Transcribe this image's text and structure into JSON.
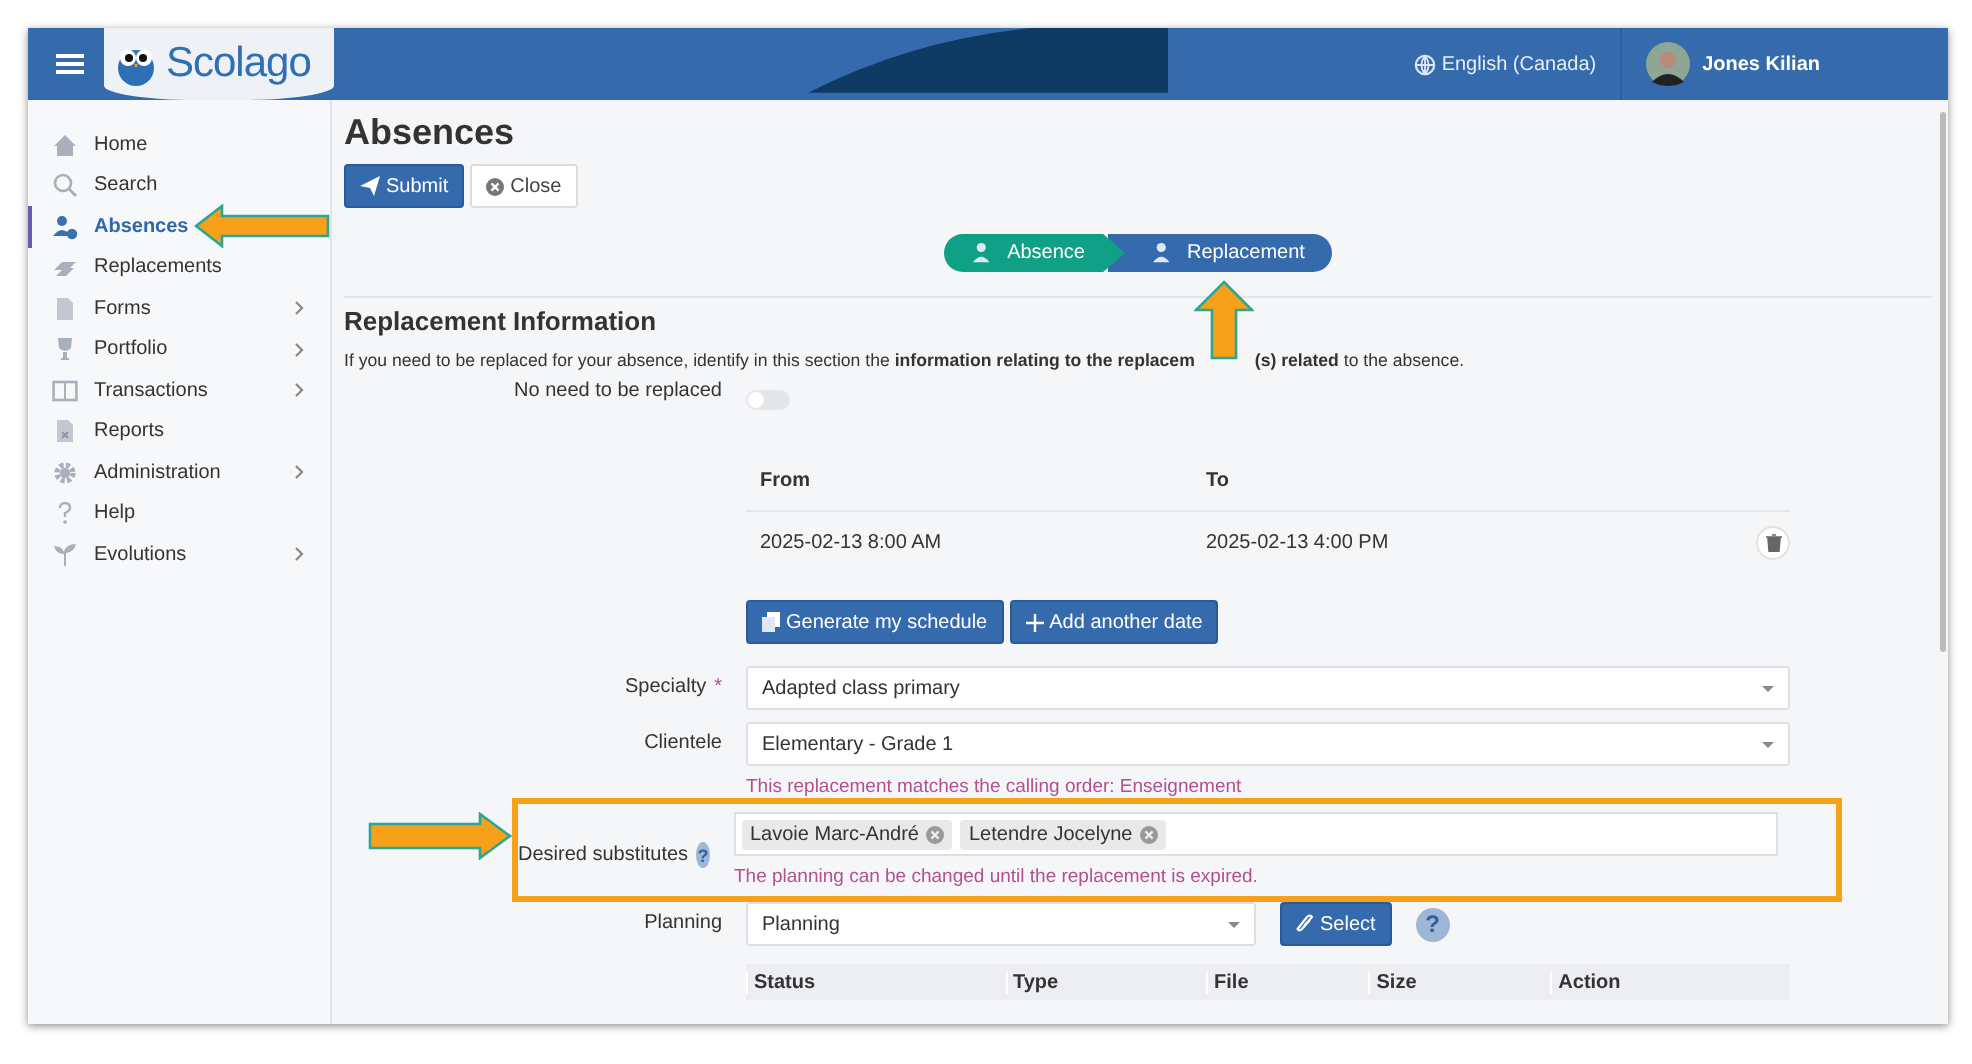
{
  "header": {
    "logo": "Scolago",
    "language": "English (Canada)",
    "user": "Jones Kilian"
  },
  "sidebar": {
    "items": [
      {
        "label": "Home",
        "selected": false,
        "submenu": false
      },
      {
        "label": "Search",
        "selected": false,
        "submenu": false
      },
      {
        "label": "Absences",
        "selected": true,
        "submenu": false
      },
      {
        "label": "Replacements",
        "selected": false,
        "submenu": false
      },
      {
        "label": "Forms",
        "selected": false,
        "submenu": true
      },
      {
        "label": "Portfolio",
        "selected": false,
        "submenu": true
      },
      {
        "label": "Transactions",
        "selected": false,
        "submenu": true
      },
      {
        "label": "Reports",
        "selected": false,
        "submenu": false
      },
      {
        "label": "Administration",
        "selected": false,
        "submenu": true
      },
      {
        "label": "Help",
        "selected": false,
        "submenu": false
      },
      {
        "label": "Evolutions",
        "selected": false,
        "submenu": true
      }
    ]
  },
  "page": {
    "title": "Absences",
    "buttons": [
      {
        "kind": "primary",
        "label": "Submit"
      },
      {
        "kind": "plain",
        "label": "Close"
      }
    ]
  },
  "stepper": [
    {
      "label": "Absence",
      "selected": false
    },
    {
      "label": "Replacement",
      "selected": true
    }
  ],
  "section": {
    "title": "Replacement Information",
    "description_start": "If you need to be replaced for your absence, identify in this section the **information relating to the replacem**",
    "description_end": "**(s) related** to the absence.",
    "no_replacement": {
      "label": "No need to be replaced",
      "on": false
    },
    "dates": {
      "columns": [
        "From",
        "To"
      ],
      "rows": [
        {
          "from": "2025-02-13 8:00 AM",
          "to": "2025-02-13 4:00 PM"
        }
      ]
    },
    "date_buttons": [
      "Generate my schedule",
      "Add another date"
    ],
    "specialty": {
      "label": "Specialty",
      "required_mark": "*",
      "value": "Adapted class primary"
    },
    "clientele": {
      "label": "Clientele",
      "value": "Elementary - Grade 1",
      "note": "This replacement matches the calling order: Enseignement"
    },
    "substitutes": {
      "label": "Desired substitutes",
      "help": "?",
      "tags": [
        "Lavoie Marc-André",
        "Letendre Jocelyne"
      ],
      "note": "The planning can be changed until the replacement is expired."
    },
    "planning": {
      "label": "Planning",
      "value": "Planning",
      "button": "Select",
      "help": "?"
    },
    "files": {
      "columns": [
        "Status",
        "Type",
        "File",
        "Size",
        "Action"
      ]
    }
  }
}
